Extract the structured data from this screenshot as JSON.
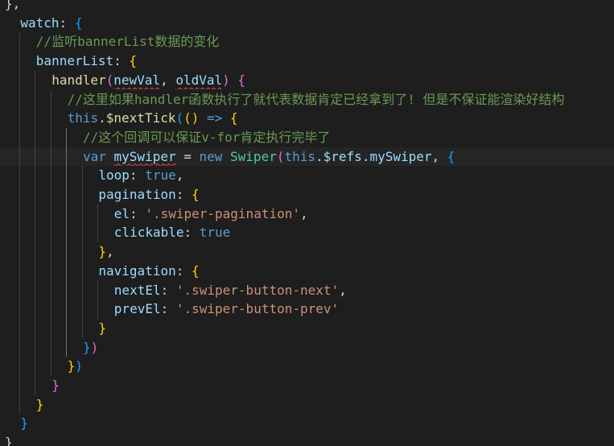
{
  "editor": {
    "colors": {
      "background": "#1e1e1e",
      "property": "#9cdcfe",
      "comment": "#6a9955",
      "function": "#dcdcaa",
      "keyword": "#569cd6",
      "string": "#ce9178",
      "class": "#4ec9b0",
      "bracket1": "#ffd700",
      "bracket2": "#da70d6",
      "bracket3": "#179fff",
      "error_squiggle": "#f14c4c"
    },
    "lines": [
      [
        {
          "t": "},",
          "c": "punc"
        }
      ],
      [
        {
          "t": "watch",
          "c": "prop"
        },
        {
          "t": ": ",
          "c": "punc"
        },
        {
          "t": "{",
          "c": "bracket3"
        }
      ],
      [
        {
          "t": "//监听bannerList数据的变化",
          "c": "comment"
        }
      ],
      [
        {
          "t": "bannerList",
          "c": "prop"
        },
        {
          "t": ": ",
          "c": "punc"
        },
        {
          "t": "{",
          "c": "bracket1"
        }
      ],
      [
        {
          "t": "handler",
          "c": "func"
        },
        {
          "t": "(",
          "c": "bracket2"
        },
        {
          "t": "newVal",
          "c": "prop",
          "sq": true
        },
        {
          "t": ", ",
          "c": "punc"
        },
        {
          "t": "oldVal",
          "c": "prop",
          "sq": true
        },
        {
          "t": ")",
          "c": "bracket2"
        },
        {
          "t": " ",
          "c": "punc"
        },
        {
          "t": "{",
          "c": "bracket2"
        }
      ],
      [
        {
          "t": "//这里如果handler函数执行了就代表数据肯定已经拿到了! 但是不保证能渲染好结构",
          "c": "comment"
        }
      ],
      [
        {
          "t": "this",
          "c": "keyword"
        },
        {
          "t": ".",
          "c": "punc"
        },
        {
          "t": "$nextTick",
          "c": "func"
        },
        {
          "t": "(",
          "c": "bracket3"
        },
        {
          "t": "()",
          "c": "bracket1"
        },
        {
          "t": " => ",
          "c": "keyword"
        },
        {
          "t": "{",
          "c": "bracket1"
        }
      ],
      [
        {
          "t": "//这个回调可以保证v-for肯定执行完毕了",
          "c": "comment"
        }
      ],
      [
        {
          "t": "var ",
          "c": "keyword"
        },
        {
          "t": "mySwiper",
          "c": "prop",
          "sq": true
        },
        {
          "t": " = ",
          "c": "punc"
        },
        {
          "t": "new ",
          "c": "keyword"
        },
        {
          "t": "Swiper",
          "c": "class"
        },
        {
          "t": "(",
          "c": "bracket2"
        },
        {
          "t": "this",
          "c": "keyword"
        },
        {
          "t": ".",
          "c": "punc"
        },
        {
          "t": "$refs",
          "c": "prop"
        },
        {
          "t": ".",
          "c": "punc"
        },
        {
          "t": "mySwiper",
          "c": "prop"
        },
        {
          "t": ", ",
          "c": "punc"
        },
        {
          "t": "{",
          "c": "bracket3"
        }
      ],
      [
        {
          "t": "loop",
          "c": "prop"
        },
        {
          "t": ": ",
          "c": "punc"
        },
        {
          "t": "true",
          "c": "keyword"
        },
        {
          "t": ",",
          "c": "punc"
        }
      ],
      [
        {
          "t": "pagination",
          "c": "prop"
        },
        {
          "t": ": ",
          "c": "punc"
        },
        {
          "t": "{",
          "c": "bracket1"
        }
      ],
      [
        {
          "t": "el",
          "c": "prop"
        },
        {
          "t": ": ",
          "c": "punc"
        },
        {
          "t": "'.swiper-pagination'",
          "c": "string"
        },
        {
          "t": ",",
          "c": "punc"
        }
      ],
      [
        {
          "t": "clickable",
          "c": "prop"
        },
        {
          "t": ": ",
          "c": "punc"
        },
        {
          "t": "true",
          "c": "keyword"
        }
      ],
      [
        {
          "t": "}",
          "c": "bracket1"
        },
        {
          "t": ",",
          "c": "punc"
        }
      ],
      [
        {
          "t": "navigation",
          "c": "prop"
        },
        {
          "t": ": ",
          "c": "punc"
        },
        {
          "t": "{",
          "c": "bracket1"
        }
      ],
      [
        {
          "t": "nextEl",
          "c": "prop"
        },
        {
          "t": ": ",
          "c": "punc"
        },
        {
          "t": "'.swiper-button-next'",
          "c": "string"
        },
        {
          "t": ",",
          "c": "punc"
        }
      ],
      [
        {
          "t": "prevEl",
          "c": "prop"
        },
        {
          "t": ": ",
          "c": "punc"
        },
        {
          "t": "'.swiper-button-prev'",
          "c": "string"
        }
      ],
      [
        {
          "t": "}",
          "c": "bracket1"
        }
      ],
      [
        {
          "t": "}",
          "c": "bracket3"
        },
        {
          "t": ")",
          "c": "bracket2"
        }
      ],
      [
        {
          "t": "}",
          "c": "bracket1"
        },
        {
          "t": ")",
          "c": "bracket3"
        }
      ],
      [
        {
          "t": "}",
          "c": "bracket2"
        }
      ],
      [
        {
          "t": "}",
          "c": "bracket1"
        }
      ],
      [
        {
          "t": "}",
          "c": "bracket3"
        }
      ],
      [
        {
          "t": "}",
          "c": "punc"
        }
      ]
    ]
  }
}
